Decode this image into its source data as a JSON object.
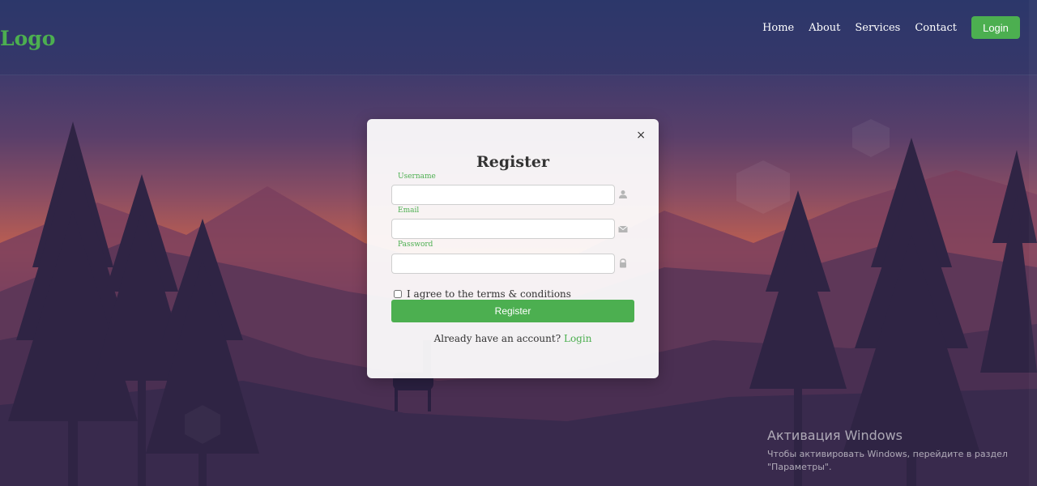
{
  "header": {
    "logo": "Logo",
    "nav": [
      "Home",
      "About",
      "Services",
      "Contact"
    ],
    "login_label": "Login"
  },
  "modal": {
    "close_glyph": "×",
    "title": "Register",
    "fields": [
      {
        "label": "Username",
        "value": "",
        "icon": "user-icon"
      },
      {
        "label": "Email",
        "value": "",
        "icon": "envelope-icon"
      },
      {
        "label": "Password",
        "value": "",
        "icon": "lock-icon"
      }
    ],
    "terms_label": "I agree to the terms & conditions",
    "register_label": "Register",
    "footer_text": "Already have an account?",
    "footer_link": "Login"
  },
  "watermark": {
    "title": "Активация Windows",
    "line1": "Чтобы активировать Windows, перейдите в раздел",
    "line2": "\"Параметры\"."
  },
  "colors": {
    "accent": "#4caf50"
  }
}
